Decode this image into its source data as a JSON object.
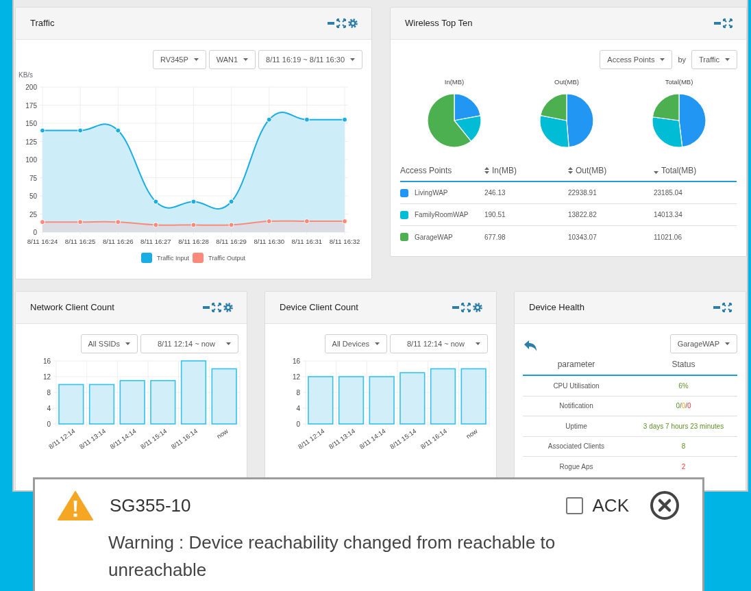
{
  "traffic": {
    "title": "Traffic",
    "has_settings": true,
    "dropdowns": [
      "RV345P",
      "WAN1",
      "8/11 16:19 ~ 8/11 16:30"
    ],
    "chart_data": {
      "type": "area",
      "grid": true,
      "legend": "bottom",
      "ylabel": "KB/s",
      "categories": [
        "8/11 16:24",
        "8/11 16:25",
        "8/11 16:26",
        "8/11 16:27",
        "8/11 16:28",
        "8/11 16:29",
        "8/11 16:30",
        "8/11 16:31",
        "8/11 16:32"
      ],
      "ylim": [
        0,
        200
      ],
      "yticks": [
        0,
        25,
        50,
        75,
        100,
        125,
        150,
        175,
        200
      ],
      "series": [
        {
          "name": "Traffic Input",
          "color": "#1aade3",
          "values": [
            140,
            140,
            140,
            42,
            42,
            42,
            155,
            155,
            155
          ]
        },
        {
          "name": "Traffic Output",
          "color": "#fa8a7a",
          "values": [
            14,
            14,
            14,
            10,
            10,
            10,
            15,
            15,
            15
          ]
        }
      ]
    }
  },
  "wireless_top_ten": {
    "title": "Wireless Top Ten",
    "has_settings": false,
    "dropdowns": [
      "Access Points",
      "Traffic"
    ],
    "by_label": "by",
    "pies": [
      {
        "chart_data": {
          "type": "pie",
          "title": "In(MB)",
          "values": [
            22.08,
            17.09,
            60.83
          ]
        }
      },
      {
        "chart_data": {
          "type": "pie",
          "title": "Out(MB)",
          "values": [
            48.7,
            29.34,
            21.96
          ]
        }
      },
      {
        "chart_data": {
          "type": "pie",
          "title": "Total(MB)",
          "values": [
            48.08,
            29.06,
            22.86
          ]
        }
      }
    ],
    "table": {
      "columns": [
        {
          "label": "Access Points",
          "kind": "plain"
        },
        {
          "label": "In(MB)",
          "kind": "sortable"
        },
        {
          "label": "Out(MB)",
          "kind": "sortable"
        },
        {
          "label": "Total(MB)",
          "kind": "sorted"
        }
      ],
      "rows": [
        {
          "name": "LivingWAP",
          "color": "#2196f3",
          "in": "246.13",
          "out": "22938.91",
          "total": "23185.04"
        },
        {
          "name": "FamilyRoomWAP",
          "color": "#00bcd4",
          "in": "190.51",
          "out": "13822.82",
          "total": "14013.34"
        },
        {
          "name": "GarageWAP",
          "color": "#4caf50",
          "in": "677.98",
          "out": "10343.07",
          "total": "11021.06"
        }
      ]
    }
  },
  "network_client_count": {
    "title": "Network Client Count",
    "has_settings": true,
    "dropdowns": [
      "All SSIDs",
      "8/11 12:14 ~ now"
    ],
    "chart_data": {
      "type": "bar",
      "grid": true,
      "categories": [
        "8/11 12:14",
        "8/11 13:14",
        "8/11 14:14",
        "8/11 15:14",
        "8/11 16:14",
        "now"
      ],
      "ylim": [
        0,
        16
      ],
      "yticks": [
        0,
        4,
        8,
        12,
        16
      ],
      "values": [
        10,
        10,
        11,
        11,
        16,
        14
      ]
    }
  },
  "device_client_count": {
    "title": "Device Client Count",
    "has_settings": true,
    "dropdowns": [
      "All Devices",
      "8/11 12:14 ~ now"
    ],
    "chart_data": {
      "type": "bar",
      "grid": true,
      "categories": [
        "8/11 12:14",
        "8/11 13:14",
        "8/11 14:14",
        "8/11 15:14",
        "8/11 16:14",
        "now"
      ],
      "ylim": [
        0,
        16
      ],
      "yticks": [
        0,
        4,
        8,
        12,
        16
      ],
      "values": [
        12,
        12,
        12,
        13,
        14,
        14
      ]
    }
  },
  "device_health": {
    "title": "Device Health",
    "has_settings": false,
    "dropdown": "GarageWAP",
    "columns": [
      "parameter",
      "Status"
    ],
    "rows": [
      {
        "parameter": "CPU Utilisation",
        "status": [
          {
            "text": "6%",
            "kind": "ok"
          }
        ]
      },
      {
        "parameter": "Notification",
        "status": [
          {
            "text": "0",
            "kind": "ok"
          },
          {
            "text": "/",
            "kind": "plain"
          },
          {
            "text": "0",
            "kind": "warn"
          },
          {
            "text": "/",
            "kind": "plain"
          },
          {
            "text": "0",
            "kind": "bad"
          }
        ]
      },
      {
        "parameter": "Uptime",
        "status": [
          {
            "text": "3 days 7 hours 23 minutes",
            "kind": "ok"
          }
        ]
      },
      {
        "parameter": "Associated Clients",
        "status": [
          {
            "text": "8",
            "kind": "ok"
          }
        ]
      },
      {
        "parameter": "Rogue Aps",
        "status": [
          {
            "text": "2",
            "kind": "bad"
          }
        ]
      }
    ]
  },
  "alert": {
    "device": "SG355-10",
    "ack_label": "ACK",
    "ack_checked": false,
    "message": "Warning : Device reachability changed from reachable to unreachable"
  }
}
